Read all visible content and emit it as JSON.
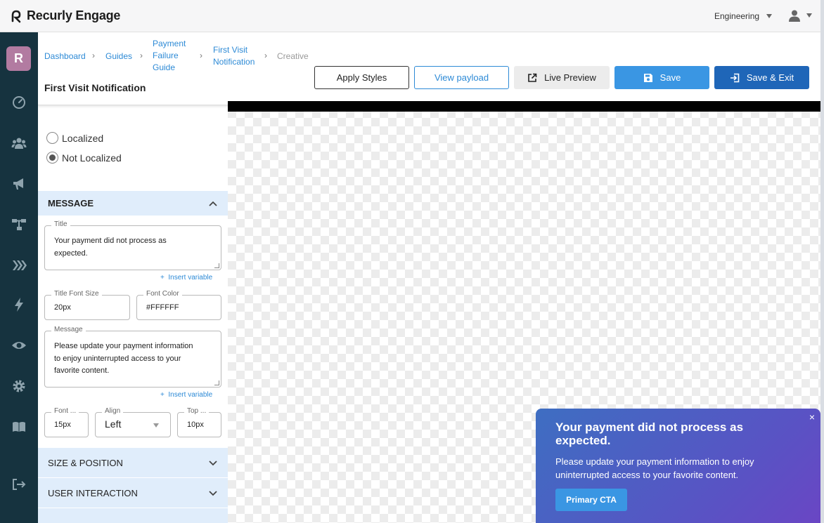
{
  "app": {
    "name": "Recurly Engage"
  },
  "topbar": {
    "workspace": "Engineering"
  },
  "nav": {
    "avatar_letter": "R",
    "icons": [
      "dashboard-icon",
      "users-icon",
      "megaphone-icon",
      "flow-icon",
      "layers-icon",
      "bolt-icon",
      "eye-icon",
      "gear-icon",
      "book-icon",
      "logout-icon"
    ]
  },
  "breadcrumb": {
    "dashboard": "Dashboard",
    "guides": "Guides",
    "guide_l1": "Payment",
    "guide_l2": "Failure",
    "guide_l3": "Guide",
    "notif_l1": "First Visit",
    "notif_l2": "Notification",
    "current": "Creative",
    "sep": "›"
  },
  "page": {
    "title": "First Visit Notification"
  },
  "toolbar": {
    "apply_styles": "Apply Styles",
    "view_payload": "View payload",
    "live_preview": "Live Preview",
    "save": "Save",
    "save_exit": "Save & Exit"
  },
  "localization": {
    "localized": "Localized",
    "not_localized": "Not Localized",
    "selected": "Not Localized"
  },
  "message_section": {
    "header": "MESSAGE",
    "title_label": "Title",
    "title_line1": "Your payment did not process as",
    "title_line2": "expected.",
    "insert_variable": "Insert variable",
    "title_font_size_label": "Title Font Size",
    "title_font_size": "20px",
    "font_color_label": "Font Color",
    "font_color": "#FFFFFF",
    "message_label": "Message",
    "message_line1": "Please update your payment information",
    "message_line2": "to enjoy uninterrupted access to your",
    "message_line3": "favorite content.",
    "font_label": "Font ...",
    "font_value": "15px",
    "align_label": "Align",
    "align_value": "Left",
    "top_label": "Top ...",
    "top_value": "10px"
  },
  "sections": {
    "size_position": "SIZE & POSITION",
    "user_interaction": "USER INTERACTION"
  },
  "preview": {
    "title_line1": "Your payment did not process as",
    "title_line2": "expected.",
    "message_line1": "Please update your payment information to enjoy",
    "message_line2": "uninterrupted access to your favorite content.",
    "cta": "Primary CTA",
    "close": "×"
  },
  "colors": {
    "nav_bg": "#16333f",
    "accent": "#3a96e3",
    "accent_dark": "#1f66b8",
    "section_bg": "#e0edfb"
  }
}
